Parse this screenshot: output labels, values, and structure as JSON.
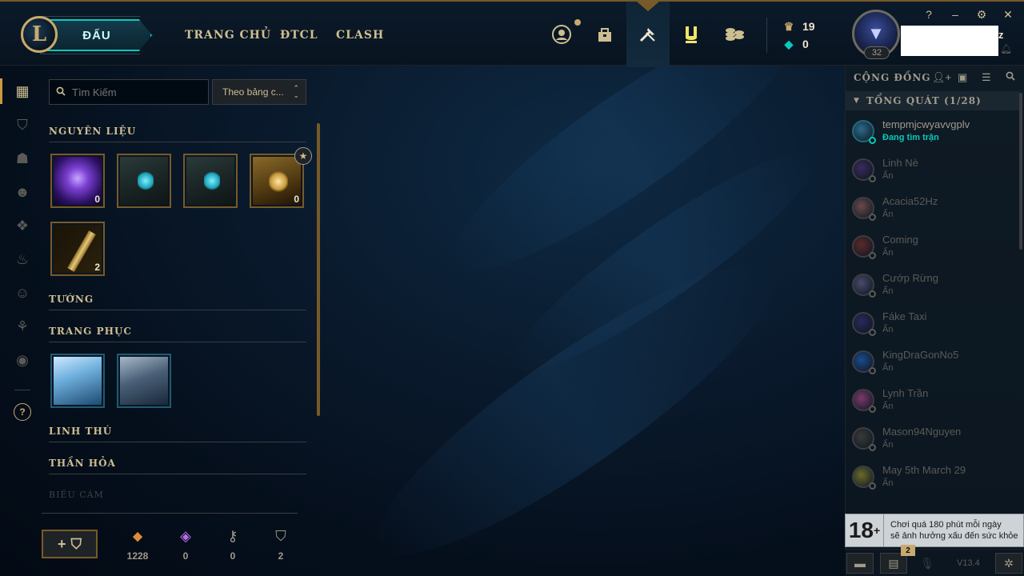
{
  "topnav": {
    "play_label": "ĐẤU",
    "links": [
      "TRANG CHỦ",
      "ĐTCL",
      "CLASH"
    ],
    "icons": [
      "profile-icon",
      "collection-icon",
      "loot-icon",
      "tft-pass-icon",
      "store-icon"
    ],
    "currency": {
      "blue_essence": "19",
      "rp": "0"
    },
    "profile": {
      "level": "32",
      "name_suffix": "z"
    },
    "window_controls": [
      "?",
      "–",
      "⚙",
      "✕"
    ]
  },
  "loot": {
    "search_placeholder": "Tìm Kiếm",
    "sort_label": "Theo bảng c...",
    "sections": {
      "materials": "NGUYÊN LIỆU",
      "champions": "TƯỚNG",
      "skins": "TRANG PHỤC",
      "pets": "LINH THÚ",
      "spells": "THẦN HỎA",
      "emotes": "BIỂU CẢM"
    },
    "material_items": [
      {
        "name": "orange-essence",
        "count": "0"
      },
      {
        "name": "hextech-chest",
        "count": ""
      },
      {
        "name": "hextech-chest",
        "count": ""
      },
      {
        "name": "masterwork-chest",
        "count": "0"
      },
      {
        "name": "hextech-key",
        "count": "2"
      }
    ],
    "bottom": {
      "craft_label": "+",
      "resources": [
        {
          "name": "orange-essence",
          "value": "1228"
        },
        {
          "name": "mythic-essence",
          "value": "0"
        },
        {
          "name": "key-fragment",
          "value": "0"
        },
        {
          "name": "chest",
          "value": "2"
        }
      ]
    }
  },
  "social": {
    "title": "CỘNG ĐỒNG",
    "group": "TỔNG QUÁT (1/28)",
    "friends": [
      {
        "name": "tempmjcwyavvgplv",
        "status": "Đang tìm trận"
      },
      {
        "name": "Linh Nè",
        "status": "Ẩn"
      },
      {
        "name": "Acacia52Hz",
        "status": "Ẩn"
      },
      {
        "name": "Coming",
        "status": "Ẩn"
      },
      {
        "name": "Cướp Rừng",
        "status": "Ẩn"
      },
      {
        "name": "Fáke Taxi",
        "status": "Ẩn"
      },
      {
        "name": "KingDraGonNo5",
        "status": "Ẩn"
      },
      {
        "name": "Lynh Trần",
        "status": "Ẩn"
      },
      {
        "name": "Mason94Nguyen",
        "status": "Ẩn"
      },
      {
        "name": "May 5th March 29",
        "status": "Ẩn"
      }
    ],
    "age_badge": "18",
    "age_plus": "+",
    "age_warning_line1": "Chơi quá 180 phút mỗi ngày",
    "age_warning_line2": "sẽ ảnh hưởng xấu đến sức khỏe",
    "footer_badge": "2",
    "version": "V13.4"
  },
  "colors": {
    "gold": "#c8aa6e",
    "teal": "#0ac8b9",
    "bg_dark": "#010a13"
  }
}
